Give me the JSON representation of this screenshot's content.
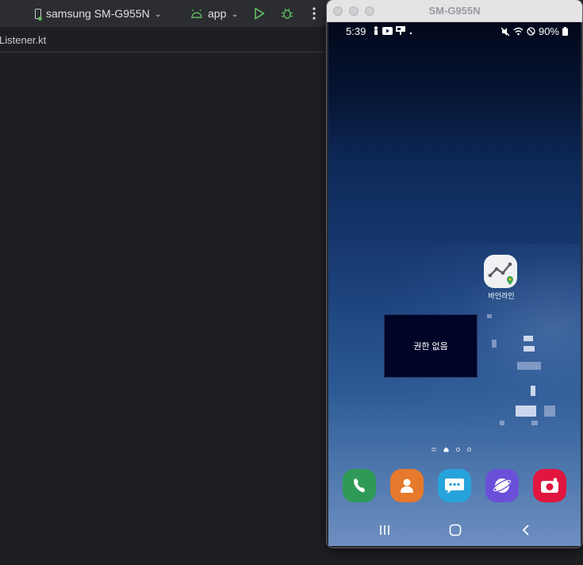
{
  "ide": {
    "device_selector": "samsung SM-G955N",
    "app_selector": "app",
    "tab_file": "Listener.kt"
  },
  "emulator": {
    "title": "SM-G955N",
    "status": {
      "time": "5:39",
      "battery": "90%"
    },
    "home": {
      "app_label": "바인라인",
      "toast": "권한 없음"
    },
    "dock": [
      "phone-app-icon",
      "contacts-app-icon",
      "messages-app-icon",
      "internet-app-icon",
      "camera-app-icon"
    ]
  },
  "colors": {
    "phone": "#2f9a57",
    "contacts": "#e6792b",
    "messages": "#27a3dc",
    "internet": "#6a50d8",
    "camera": "#e0163f",
    "run": "#5fb85f"
  }
}
